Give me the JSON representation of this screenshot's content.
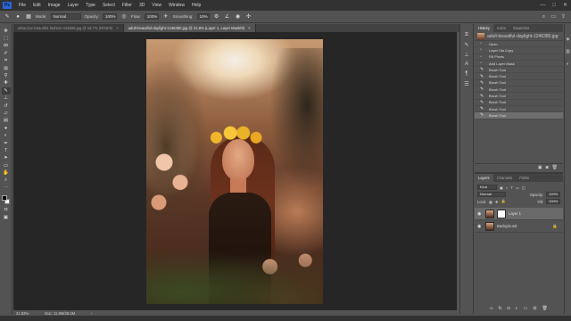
{
  "menubar": {
    "logo": "Ps",
    "items": [
      "File",
      "Edit",
      "Image",
      "Layer",
      "Type",
      "Select",
      "Filter",
      "3D",
      "View",
      "Window",
      "Help"
    ],
    "window_controls": [
      "—",
      "□",
      "✕"
    ]
  },
  "options": {
    "mode_label": "Mode:",
    "mode_value": "Normal",
    "opacity_label": "Opacity:",
    "opacity_value": "100%",
    "flow_label": "Flow:",
    "flow_value": "100%",
    "smoothing_label": "Smoothing:",
    "smoothing_value": "10%"
  },
  "tools": [
    "move-icon",
    "marquee-icon",
    "lasso-icon",
    "quick-select-icon",
    "crop-icon",
    "frame-icon",
    "eyedropper-icon",
    "healing-icon",
    "brush-icon",
    "clone-stamp-icon",
    "history-brush-icon",
    "eraser-icon",
    "gradient-icon",
    "blur-icon",
    "dodge-icon",
    "pen-icon",
    "type-icon",
    "path-select-icon",
    "rectangle-icon",
    "hand-icon",
    "zoom-icon",
    "more-tools-icon"
  ],
  "tabs": [
    {
      "label": "attractive-beautiful-fashion-443568.jpg @ 16.7% (RGB/8)",
      "active": false
    },
    {
      "label": "adult-beautiful-daylight-1246380.jpg @ 21.8% (Layer 1, Layer Mask/8)",
      "active": true
    }
  ],
  "status": {
    "zoom": "21.83%",
    "doc": "Doc: 11.9M/28.2M"
  },
  "history": {
    "tabs": [
      "History",
      "Color",
      "Swatches"
    ],
    "snapshot": "adult-beautiful-daylight-1246380.jpg",
    "items": [
      {
        "label": "Open",
        "icon": "doc-icon"
      },
      {
        "label": "Layer Via Copy",
        "icon": "doc-icon"
      },
      {
        "label": "Fill Pixels",
        "icon": "doc-icon"
      },
      {
        "label": "Add Layer Mask",
        "icon": "doc-icon"
      },
      {
        "label": "Brush Tool",
        "icon": "brush-icon"
      },
      {
        "label": "Brush Tool",
        "icon": "brush-icon"
      },
      {
        "label": "Brush Tool",
        "icon": "brush-icon"
      },
      {
        "label": "Brush Tool",
        "icon": "brush-icon"
      },
      {
        "label": "Brush Tool",
        "icon": "brush-icon"
      },
      {
        "label": "Brush Tool",
        "icon": "brush-icon"
      },
      {
        "label": "Brush Tool",
        "icon": "brush-icon"
      },
      {
        "label": "Brush Tool",
        "icon": "brush-icon"
      }
    ],
    "selected_index": 11
  },
  "layers": {
    "tabs": [
      "Layers",
      "Channels",
      "Paths"
    ],
    "kind_label": "Kind",
    "blend": "Normal",
    "opacity_label": "Opacity:",
    "opacity_value": "100%",
    "lock_label": "Lock:",
    "fill_label": "Fill:",
    "fill_value": "100%",
    "items": [
      {
        "name": "Layer 1",
        "selected": true
      },
      {
        "name": "Background",
        "selected": false
      }
    ]
  }
}
